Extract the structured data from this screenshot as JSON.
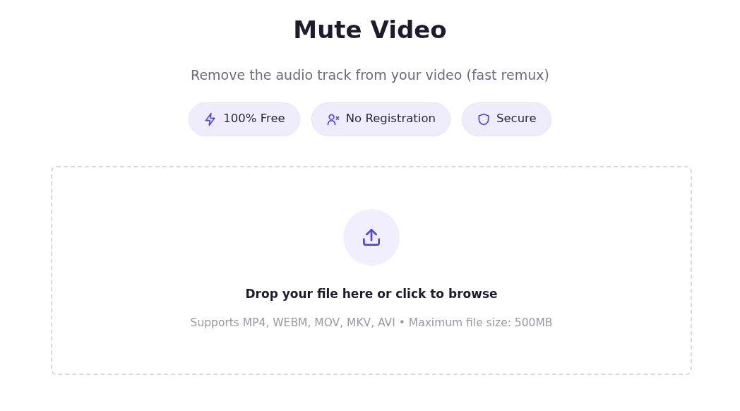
{
  "title": "Mute Video",
  "subtitle": "Remove the audio track from your video (fast remux)",
  "badges": [
    {
      "kind": "bolt",
      "label": "100% Free"
    },
    {
      "kind": "user-x",
      "label": "No Registration"
    },
    {
      "kind": "shield",
      "label": "Secure"
    }
  ],
  "dropzone": {
    "prompt": "Drop your file here or click to browse",
    "hint": "Supports MP4, WEBM, MOV, MKV, AVI • Maximum file size: 500MB"
  }
}
